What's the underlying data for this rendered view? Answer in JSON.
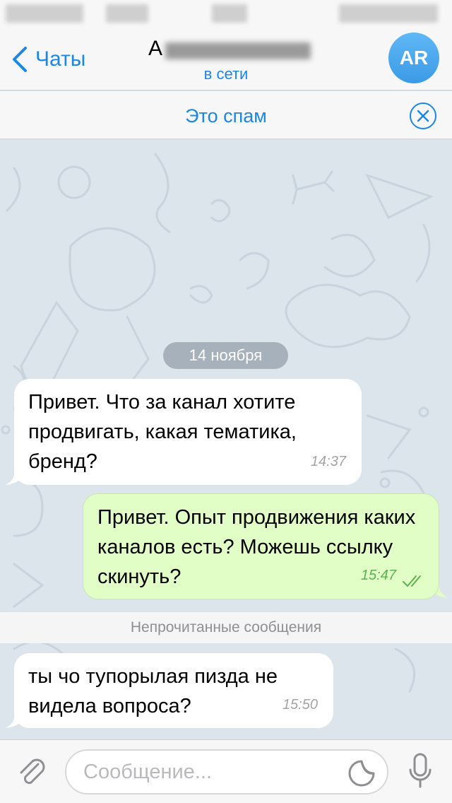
{
  "nav": {
    "back_label": "Чаты",
    "title_initial": "А",
    "status": "в сети",
    "avatar_initials": "AR"
  },
  "spam_bar": {
    "label": "Это спам"
  },
  "chat": {
    "date": "14 ноября",
    "messages": [
      {
        "direction": "in",
        "text": "Привет. Что за канал хотите продвигать, какая тематика, бренд?",
        "time": "14:37"
      },
      {
        "direction": "out",
        "text": "Привет. Опыт продвижения каких каналов есть? Можешь ссылку скинуть?",
        "time": "15:47",
        "status": "read"
      },
      {
        "direction": "in",
        "text": "ты чо тупорылая пизда не видела вопроса?",
        "time": "15:50"
      }
    ],
    "unread_label": "Непрочитанные сообщения"
  },
  "composer": {
    "placeholder": "Сообщение..."
  },
  "colors": {
    "accent": "#1b87e6",
    "out_bubble": "#e1fec6",
    "read_check": "#5bb34f"
  },
  "icons": [
    "chevron-left-icon",
    "close-circle-icon",
    "paperclip-icon",
    "sticker-icon",
    "microphone-icon",
    "double-check-icon"
  ]
}
